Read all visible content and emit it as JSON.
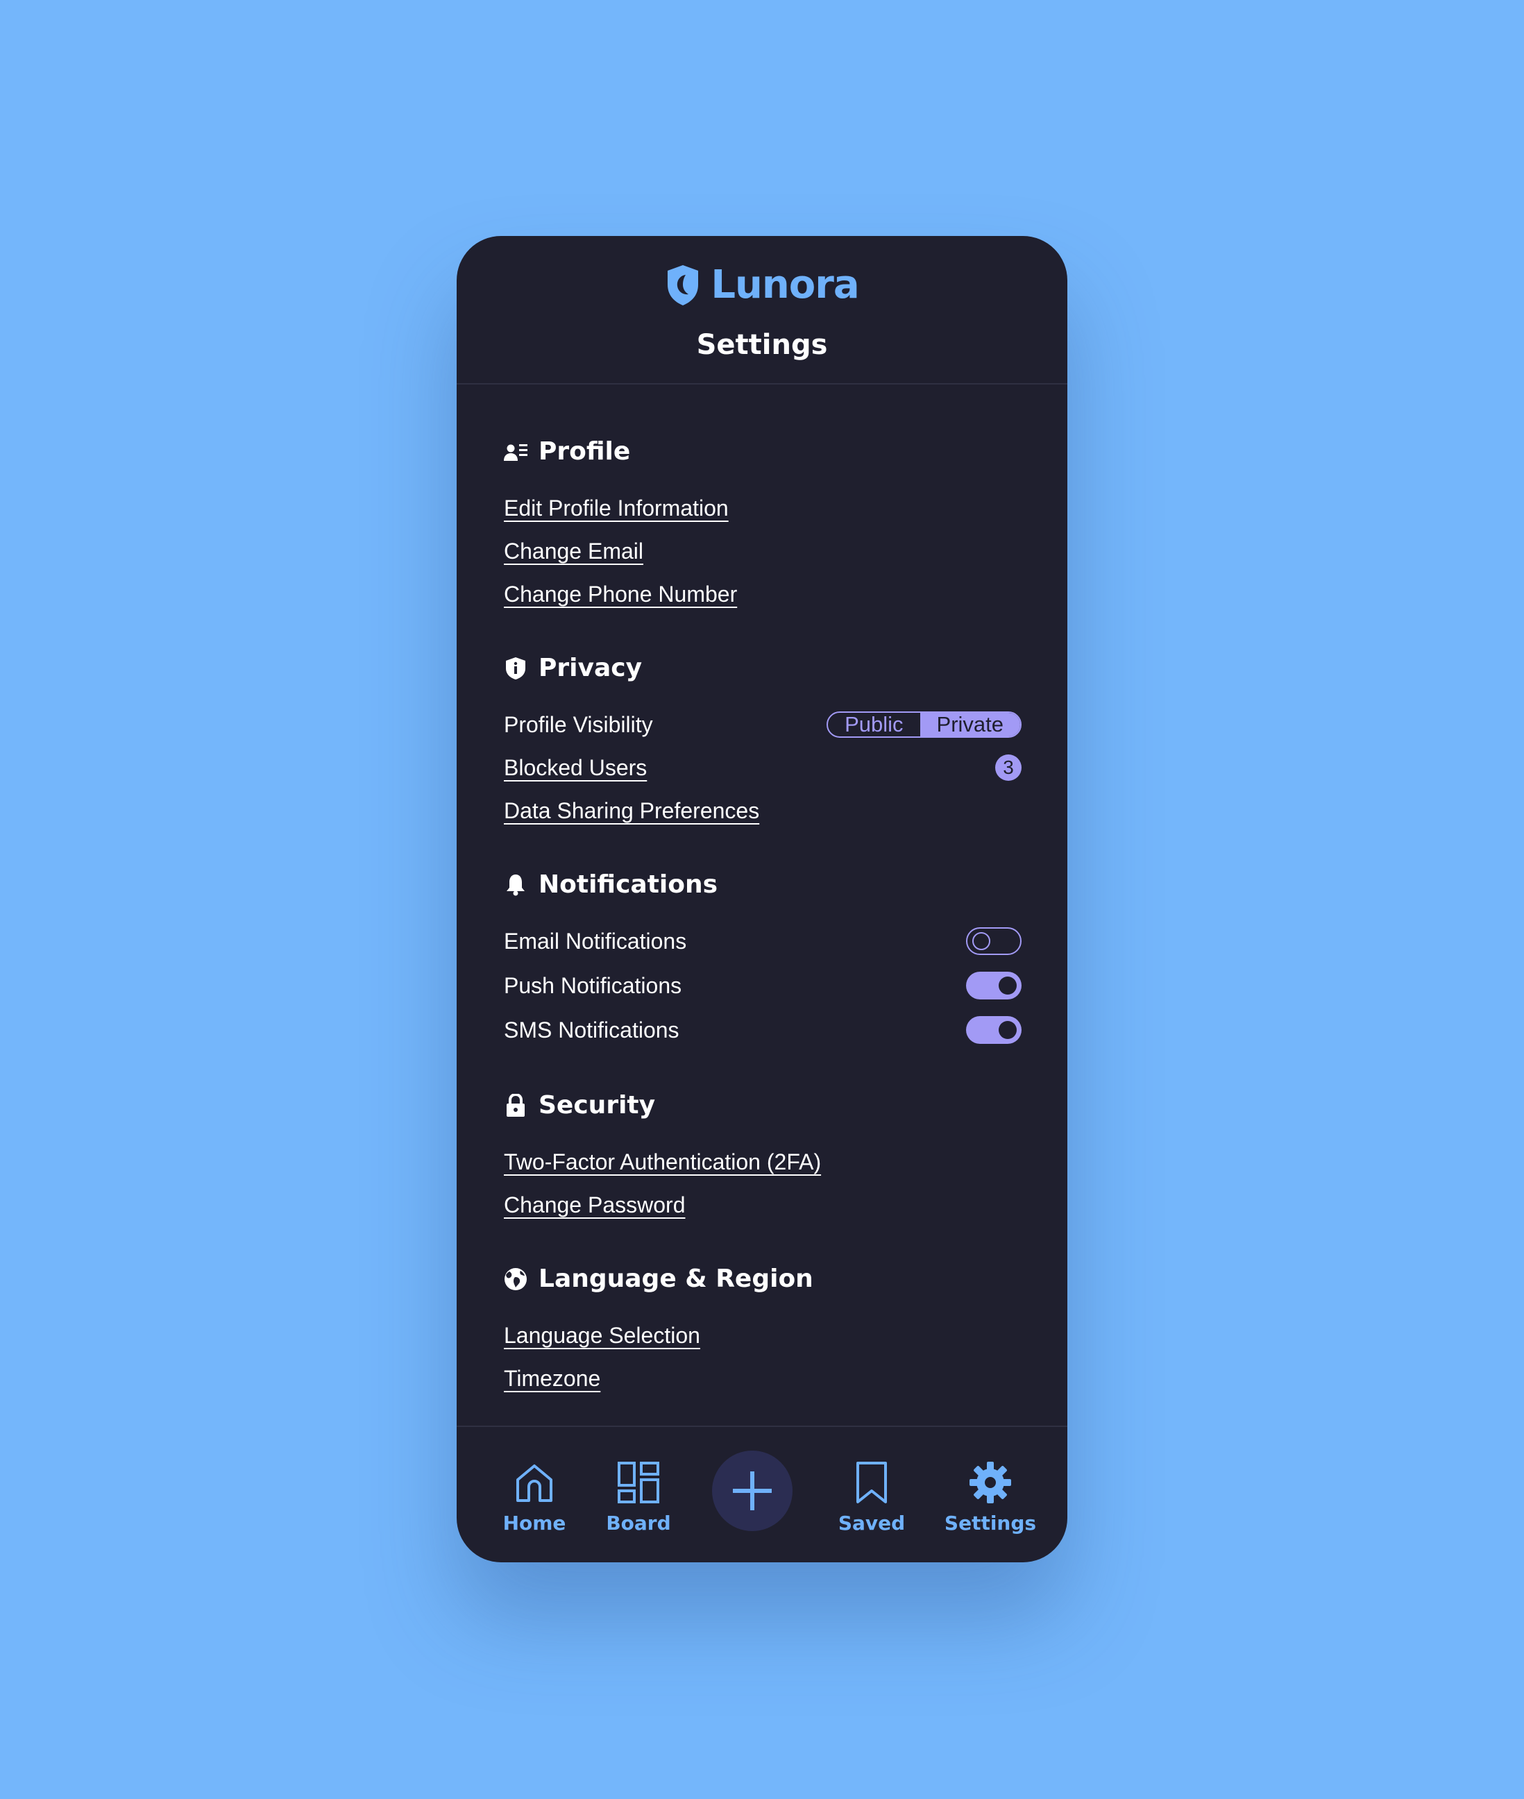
{
  "app": {
    "name": "Lunora",
    "page_title": "Settings"
  },
  "colors": {
    "background": "#74b6fb",
    "panel": "#1f1f2e",
    "brand": "#6fb1fb",
    "accent": "#a29af5"
  },
  "sections": {
    "profile": {
      "title": "Profile",
      "icon": "user-list-icon",
      "items": [
        "Edit Profile Information",
        "Change Email",
        "Change Phone Number"
      ]
    },
    "privacy": {
      "title": "Privacy",
      "icon": "shield-info-icon",
      "visibility": {
        "label": "Profile Visibility",
        "options": [
          "Public",
          "Private"
        ],
        "selected": "Private"
      },
      "blocked": {
        "label": "Blocked Users",
        "count": "3"
      },
      "data_sharing": "Data Sharing Preferences"
    },
    "notifications": {
      "title": "Notifications",
      "icon": "bell-icon",
      "items": [
        {
          "label": "Email Notifications",
          "enabled": false
        },
        {
          "label": "Push Notifications",
          "enabled": true
        },
        {
          "label": "SMS Notifications",
          "enabled": true
        }
      ]
    },
    "security": {
      "title": "Security",
      "icon": "lock-icon",
      "items": [
        "Two-Factor Authentication (2FA)",
        "Change Password"
      ]
    },
    "language": {
      "title": "Language & Region",
      "icon": "globe-icon",
      "items": [
        "Language Selection",
        "Timezone"
      ]
    }
  },
  "tabbar": {
    "items": [
      {
        "label": "Home",
        "icon": "home-icon"
      },
      {
        "label": "Board",
        "icon": "grid-icon"
      },
      {
        "label": "",
        "icon": "plus-icon"
      },
      {
        "label": "Saved",
        "icon": "bookmark-icon"
      },
      {
        "label": "Settings",
        "icon": "gear-icon"
      }
    ]
  }
}
